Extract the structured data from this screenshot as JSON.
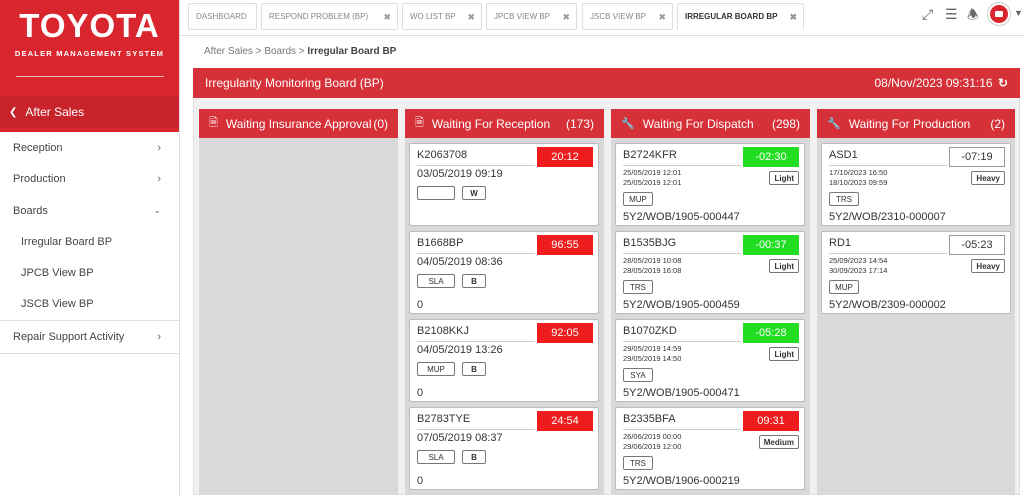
{
  "brand": {
    "logo": "TOYOTA",
    "subtitle": "DEALER MANAGEMENT SYSTEM"
  },
  "sidebar": {
    "back_label": "After Sales",
    "items": [
      {
        "label": "Reception"
      },
      {
        "label": "Production"
      },
      {
        "label": "Boards"
      }
    ],
    "sub_items": [
      {
        "label": "Irregular Board BP"
      },
      {
        "label": "JPCB View BP"
      },
      {
        "label": "JSCB View BP"
      }
    ],
    "extra_item": {
      "label": "Repair Support Activity"
    }
  },
  "tabs": [
    {
      "label": "DASHBOARD"
    },
    {
      "label": "RESPOND PROBLEM (BP)"
    },
    {
      "label": "WO LIST BP"
    },
    {
      "label": "JPCB VIEW BP"
    },
    {
      "label": "JSCB VIEW BP"
    },
    {
      "label": "IRREGULAR BOARD BP"
    }
  ],
  "breadcrumb": {
    "part1": "After Sales",
    "part2": "Boards",
    "current": "Irregular Board BP"
  },
  "board": {
    "title": "Irregularity Monitoring Board (BP)",
    "datetime": "08/Nov/2023 09:31:16"
  },
  "columns": [
    {
      "title": "Waiting Insurance Approval",
      "count": "(0)",
      "icon": "document-icon"
    },
    {
      "title": "Waiting For Reception",
      "count": "(173)",
      "icon": "document-icon"
    },
    {
      "title": "Waiting For Dispatch",
      "count": "(298)",
      "icon": "wrench-icon"
    },
    {
      "title": "Waiting For Production",
      "count": "(2)",
      "icon": "wrench-icon"
    }
  ],
  "reception_cards": [
    {
      "plate": "K2063708",
      "timer": "20:12",
      "date": "03/05/2019 09:19",
      "tag1": "",
      "tag2": "W",
      "footer": ""
    },
    {
      "plate": "B1668BP",
      "timer": "96:55",
      "date": "04/05/2019 08:36",
      "tag1": "SLA",
      "tag2": "B",
      "footer": "0"
    },
    {
      "plate": "B2108KKJ",
      "timer": "92:05",
      "date": "04/05/2019 13:26",
      "tag1": "MUP",
      "tag2": "B",
      "footer": "0"
    },
    {
      "plate": "B2783TYE",
      "timer": "24:54",
      "date": "07/05/2019 08:37",
      "tag1": "SLA",
      "tag2": "B",
      "footer": "0"
    }
  ],
  "dispatch_cards": [
    {
      "plate": "B2724KFR",
      "timer": "-02:30",
      "timer_color": "green",
      "d1": "25/05/2019 12:01",
      "d2": "25/05/2019 12:01",
      "sev": "Light",
      "tag": "MUP",
      "wo": "5Y2/WOB/1905-000447"
    },
    {
      "plate": "B1535BJG",
      "timer": "-00:37",
      "timer_color": "green",
      "d1": "28/05/2019 10:08",
      "d2": "28/05/2019 16:08",
      "sev": "Light",
      "tag": "TRS",
      "wo": "5Y2/WOB/1905-000459"
    },
    {
      "plate": "B1070ZKD",
      "timer": "-05:28",
      "timer_color": "green",
      "d1": "29/05/2019 14:59",
      "d2": "29/05/2019 14:50",
      "sev": "Light",
      "tag": "SYA",
      "wo": "5Y2/WOB/1905-000471"
    },
    {
      "plate": "B2335BFA",
      "timer": "09:31",
      "timer_color": "red",
      "d1": "26/06/2019 00:00",
      "d2": "29/06/2019 12:00",
      "sev": "Medium",
      "tag": "TRS",
      "wo": "5Y2/WOB/1906-000219"
    }
  ],
  "production_cards": [
    {
      "plate": "ASD1",
      "timer": "-07:19",
      "d1": "17/10/2023 16:50",
      "d2": "18/10/2023 09:59",
      "sev": "Heavy",
      "tag": "TRS",
      "wo": "5Y2/WOB/2310-000007"
    },
    {
      "plate": "RD1",
      "timer": "-05:23",
      "d1": "25/09/2023 14:54",
      "d2": "30/09/2023 17:14",
      "sev": "Heavy",
      "tag": "MUP",
      "wo": "5Y2/WOB/2309-000002"
    }
  ],
  "colors": {
    "brand_red": "#d9262e",
    "header_red": "#d63038",
    "timer_red": "#ee1c1c",
    "timer_green": "#22dd22"
  }
}
